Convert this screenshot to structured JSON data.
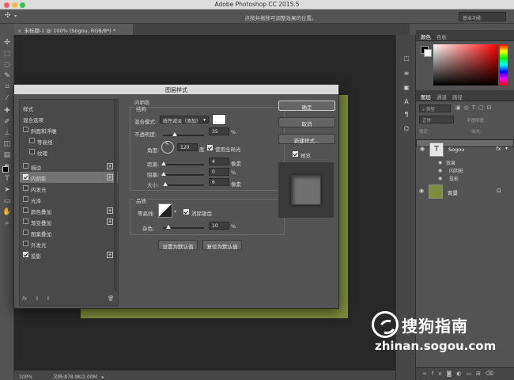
{
  "app_title": "Adobe Photoshop CC 2015.5",
  "options_bar": {
    "hint": "点按并拖移可调整效果的位置。",
    "workspace": "基本功能"
  },
  "doc_tab": "未标题-1 @ 100% (Sogou, RGB/8*) *",
  "status": {
    "zoom": "100%",
    "doc": "文档:878.9K/2.00M"
  },
  "panels": {
    "color_tabs": [
      "颜色",
      "色板"
    ],
    "layer_tabs": [
      "图层",
      "通道",
      "路径"
    ],
    "layer_kind": "类型",
    "blend": "正常",
    "opacity_label": "不透明度:",
    "lock_label": "锁定:",
    "fill_label": "填充:",
    "layers": [
      {
        "name": "Sogou",
        "thumb": "T",
        "fx": "fx"
      },
      {
        "name": "背景"
      }
    ],
    "effects_label": "效果",
    "effect_items": [
      "内阴影",
      "投影"
    ]
  },
  "dialog": {
    "title": "图层样式",
    "styles_header": "样式",
    "blend_options": "混合选项",
    "style_items": [
      {
        "label": "斜面和浮雕",
        "checked": false,
        "plus": false
      },
      {
        "label": "等高线",
        "checked": false,
        "plus": false
      },
      {
        "label": "纹理",
        "checked": false,
        "plus": false
      },
      {
        "label": "描边",
        "checked": false,
        "plus": true
      },
      {
        "label": "内阴影",
        "checked": true,
        "plus": true
      },
      {
        "label": "内发光",
        "checked": false,
        "plus": false
      },
      {
        "label": "光泽",
        "checked": false,
        "plus": false
      },
      {
        "label": "颜色叠加",
        "checked": false,
        "plus": true
      },
      {
        "label": "渐变叠加",
        "checked": false,
        "plus": true
      },
      {
        "label": "图案叠加",
        "checked": false,
        "plus": false
      },
      {
        "label": "外发光",
        "checked": false,
        "plus": false
      },
      {
        "label": "投影",
        "checked": true,
        "plus": true
      }
    ],
    "footer_icons": [
      "fx",
      "⇧",
      "⇩",
      "🗑"
    ],
    "section": "内阴影",
    "structure": "结构",
    "blend_mode_label": "混合模式:",
    "blend_mode": "线性减淡（添加）",
    "opacity_label": "不透明度:",
    "opacity": "35",
    "angle_label": "角度:",
    "angle": "120",
    "degree": "度",
    "global_light": "使用全局光",
    "distance_label": "距离:",
    "distance": "4",
    "choke_label": "阻塞:",
    "choke": "0",
    "size_label": "大小:",
    "size": "6",
    "px": "像素",
    "percent": "%",
    "quality": "品质",
    "contour_label": "等高线:",
    "antialias": "消除锯齿",
    "noise_label": "杂色:",
    "noise": "10",
    "make_default": "设置为默认值",
    "reset_default": "复位为默认值",
    "ok": "确定",
    "cancel": "取消",
    "new_style": "新建样式...",
    "preview": "预览"
  },
  "watermark": {
    "brand": "搜狗指南",
    "url": "zhinan.sogou.com"
  }
}
